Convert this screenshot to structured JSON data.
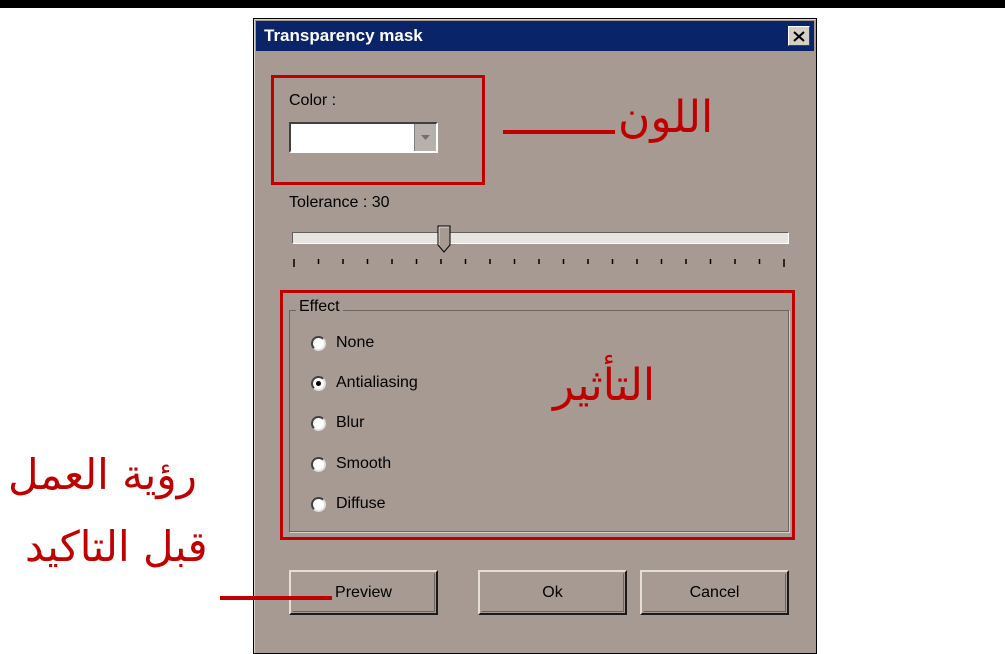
{
  "dialog": {
    "title": "Transparency mask",
    "color_label": "Color :",
    "tolerance_label": "Tolerance : 30",
    "tolerance_value": 30,
    "effect_group_label": "Effect",
    "effects": [
      {
        "label": "None",
        "selected": false
      },
      {
        "label": "Antialiasing",
        "selected": true
      },
      {
        "label": "Blur",
        "selected": false
      },
      {
        "label": "Smooth",
        "selected": false
      },
      {
        "label": "Diffuse",
        "selected": false
      }
    ],
    "buttons": {
      "preview": "Preview",
      "ok": "Ok",
      "cancel": "Cancel"
    }
  },
  "annotations": {
    "color": "اللون",
    "effect": "التأثير",
    "preview_line1": "رؤية العمل",
    "preview_line2": "قبل التاكيد"
  },
  "colors": {
    "dialog_bg": "#a69a92",
    "titlebar": "#0a246a",
    "annotation_red": "#c00000"
  }
}
